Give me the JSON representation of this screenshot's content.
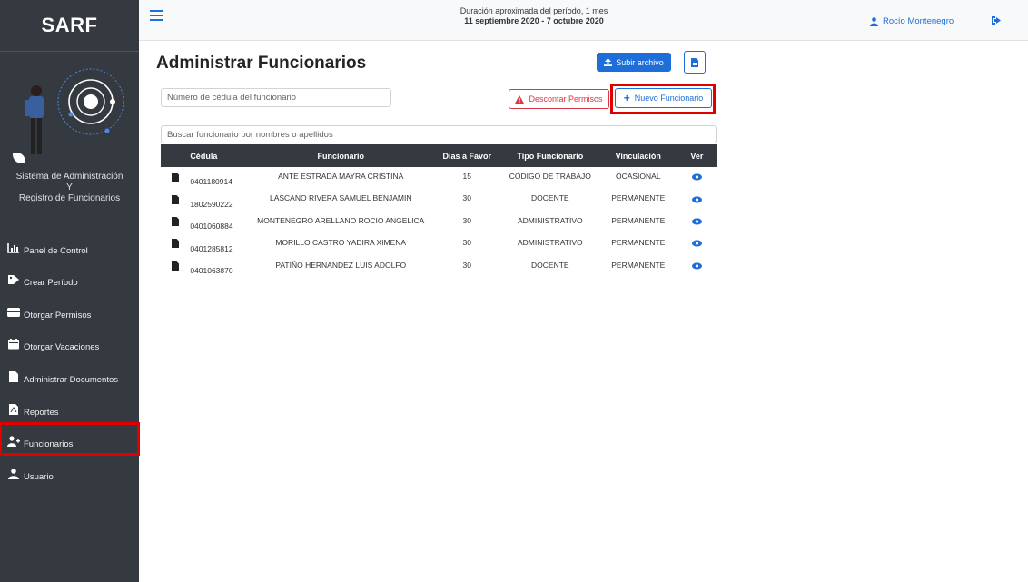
{
  "brand": "SARF",
  "sidebar": {
    "subtitle_line1": "Sistema de Administración",
    "subtitle_line2": "Y",
    "subtitle_line3": "Registro de Funcionarios",
    "items": [
      {
        "label": "Panel de Control",
        "icon": "chart-icon"
      },
      {
        "label": "Crear Período",
        "icon": "tag-icon"
      },
      {
        "label": "Otorgar Permisos",
        "icon": "card-icon"
      },
      {
        "label": "Otorgar Vacaciones",
        "icon": "calendar-icon"
      },
      {
        "label": "Administrar Documentos",
        "icon": "file-icon"
      },
      {
        "label": "Reportes",
        "icon": "pdf-file-icon"
      },
      {
        "label": "Funcionarios",
        "icon": "user-plus-icon"
      },
      {
        "label": "Usuario",
        "icon": "user-icon"
      }
    ]
  },
  "topbar": {
    "period_line1": "Duración aproximada del período, 1 mes",
    "period_line2": "11 septiembre 2020 - 7 octubre 2020",
    "user_name": "Rocío Montenegro"
  },
  "main": {
    "title": "Administrar Funcionarios",
    "upload_label": "Subir archivo",
    "cedula_placeholder": "Número de cédula del funcionario",
    "descontar_label": "Descontar Permisos",
    "nuevo_label": "Nuevo Funcionario",
    "search_placeholder": "Buscar funcionario por nombres o apellidos"
  },
  "table": {
    "headers": [
      "Cédula",
      "Funcionario",
      "Días a Favor",
      "Tipo Funcionario",
      "Vinculación",
      "Ver"
    ],
    "rows": [
      {
        "cedula": "0401180914",
        "funcionario": "ANTE ESTRADA MAYRA CRISTINA",
        "dias": "15",
        "tipo": "CÓDIGO DE TRABAJO",
        "vinculacion": "OCASIONAL"
      },
      {
        "cedula": "1802590222",
        "funcionario": "LASCANO RIVERA SAMUEL BENJAMIN",
        "dias": "30",
        "tipo": "DOCENTE",
        "vinculacion": "PERMANENTE"
      },
      {
        "cedula": "0401060884",
        "funcionario": "MONTENEGRO ARELLANO ROCIO ANGELICA",
        "dias": "30",
        "tipo": "ADMINISTRATIVO",
        "vinculacion": "PERMANENTE"
      },
      {
        "cedula": "0401285812",
        "funcionario": "MORILLO CASTRO YADIRA XIMENA",
        "dias": "30",
        "tipo": "ADMINISTRATIVO",
        "vinculacion": "PERMANENTE"
      },
      {
        "cedula": "0401063870",
        "funcionario": "PATIÑO HERNANDEZ LUIS ADOLFO",
        "dias": "30",
        "tipo": "DOCENTE",
        "vinculacion": "PERMANENTE"
      }
    ]
  },
  "colors": {
    "sidebar_bg": "#343a40",
    "primary": "#1d6ed8",
    "danger": "#dc3545",
    "highlight": "#e00000"
  }
}
